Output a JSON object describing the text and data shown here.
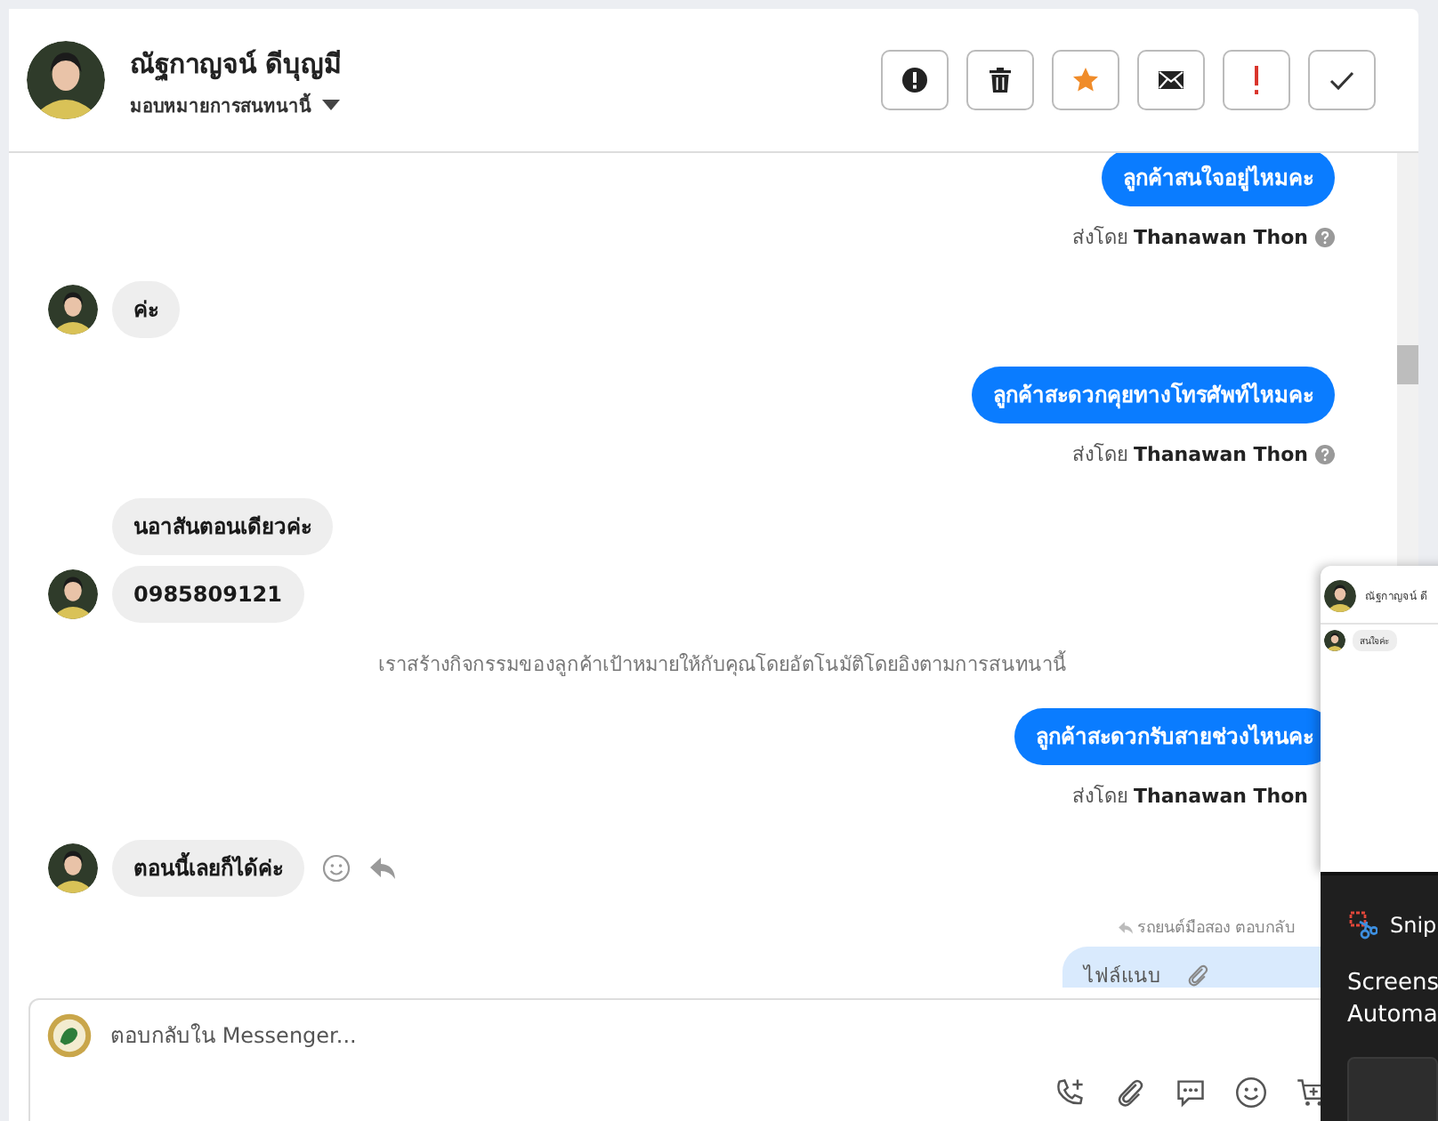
{
  "contact": {
    "name": "ณัฐกาญจน์ ดีบุญมี",
    "assign": "มอบหมายการสนทนานี้"
  },
  "messages": [
    {
      "kind": "out",
      "text": "ลูกค้าสนใจอยู่ไหมคะ"
    },
    {
      "kind": "sent_by",
      "text": "ส่งโดย **Thanawan Thon**",
      "help": true
    },
    {
      "kind": "in",
      "text": "ค่ะ",
      "avatar": true,
      "actions": false
    },
    {
      "kind": "out",
      "text": "ลูกค้าสะดวกคุยทางโทรศัพท์ไหมคะ"
    },
    {
      "kind": "sent_by",
      "text": "ส่งโดย **Thanawan Thon**",
      "help": true
    },
    {
      "kind": "in",
      "text": "นอาสันตอนเดียวค่ะ",
      "avatar": false,
      "actions": false
    },
    {
      "kind": "in",
      "text": "0985809121",
      "avatar": true,
      "actions": false
    },
    {
      "kind": "system",
      "text": "เราสร้างกิจกรรมของลูกค้าเป้าหมายให้กับคุณโดยอัตโนมัติโดยอิงตามการสนทนานี้"
    },
    {
      "kind": "out",
      "text": "ลูกค้าสะดวกรับสายช่วงไหนคะ"
    },
    {
      "kind": "sent_by",
      "text": "ส่งโดย **Thanawan Thon**",
      "help": false
    },
    {
      "kind": "in",
      "text": "ตอนนี้เลยก็ได้ค่ะ",
      "avatar": true,
      "actions": true
    },
    {
      "kind": "reply_ref",
      "text": "รถยนต์มือสอง ตอบกลับ"
    },
    {
      "kind": "attachment",
      "text": "ไฟล์แนบ"
    }
  ],
  "composer": {
    "placeholder": "ตอบกลับใน Messenger..."
  },
  "snip_preview": {
    "name": "ณัฐกาญจน์ ดี",
    "message": "สนใจค่ะ"
  },
  "notification": {
    "app": "Snip",
    "lines": [
      "Screens",
      "Automa"
    ]
  }
}
